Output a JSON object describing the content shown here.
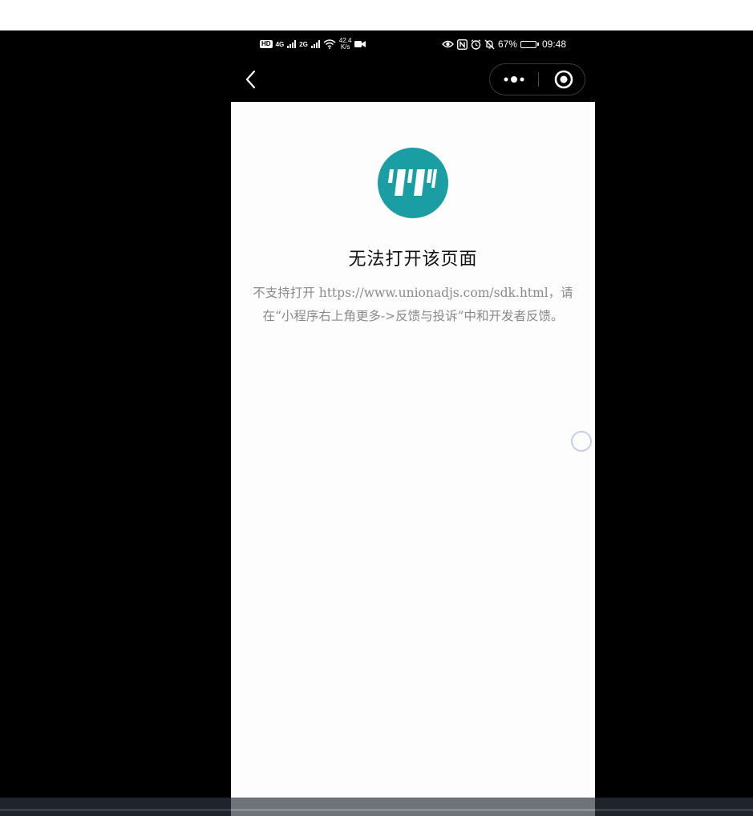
{
  "status_bar": {
    "hd": "HD",
    "sim1_type": "4G",
    "sim2_type": "2G",
    "net_speed_value": "42.4",
    "net_speed_unit": "K/s",
    "battery_percent": "67%",
    "battery_level": 0.67,
    "time": "09:48",
    "icons": [
      "hd-icon",
      "signal-icon",
      "wifi-icon",
      "video-icon",
      "eye-icon",
      "nfc-icon",
      "alarm-icon",
      "mute-icon",
      "battery-icon"
    ]
  },
  "nav": {
    "back_icon": "chevron-left-icon",
    "more_icon": "more-dots-icon",
    "close_icon": "target-circle-icon"
  },
  "error": {
    "title": "无法打开该页面",
    "message": "不支持打开 https://www.unionadjs.com/sdk.html，请在“小程序右上角更多->反馈与投诉”中和开发者反馈。"
  },
  "colors": {
    "logo": "#1a9ea4",
    "title": "#111111",
    "message": "#8a8a8a",
    "background": "#fdfdfd",
    "frame": "#000000"
  }
}
